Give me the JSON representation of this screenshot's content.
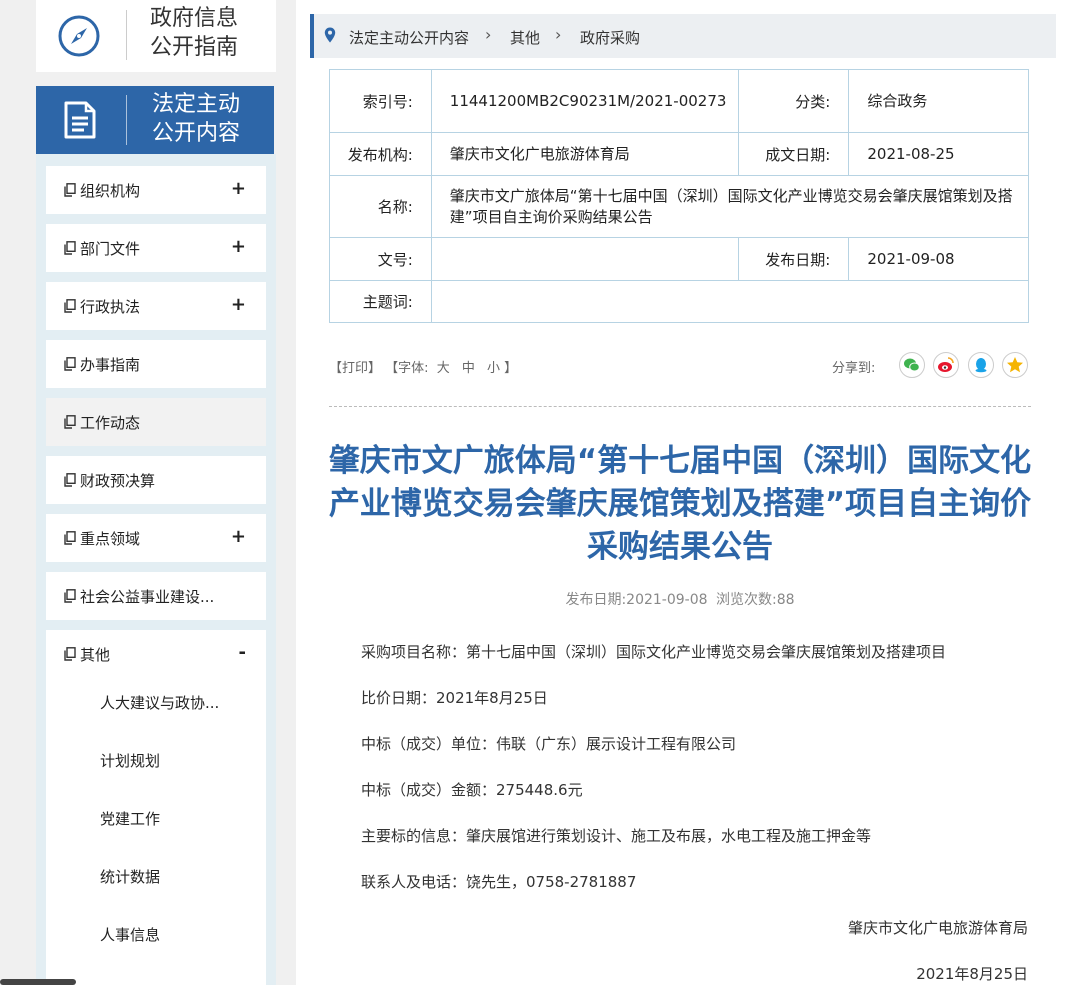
{
  "sidebar": {
    "guide_title_line1": "政府信息",
    "guide_title_line2": "公开指南",
    "legal_title_line1": "法定主动",
    "legal_title_line2": "公开内容",
    "items": [
      {
        "label": "组织机构",
        "toggle": "+"
      },
      {
        "label": "部门文件",
        "toggle": "+"
      },
      {
        "label": "行政执法",
        "toggle": "+"
      },
      {
        "label": "办事指南",
        "toggle": ""
      },
      {
        "label": "工作动态",
        "toggle": ""
      },
      {
        "label": "财政预决算",
        "toggle": ""
      },
      {
        "label": "重点领域",
        "toggle": "+"
      },
      {
        "label": "社会公益事业建设...",
        "toggle": ""
      },
      {
        "label": "其他",
        "toggle": "-"
      }
    ],
    "sub_items": [
      "人大建议与政协...",
      "计划规划",
      "党建工作",
      "统计数据",
      "人事信息"
    ]
  },
  "breadcrumb": [
    "法定主动公开内容",
    "其他",
    "政府采购"
  ],
  "meta": {
    "index_label": "索引号:",
    "index_value": "11441200MB2C90231M/2021-00273",
    "category_label": "分类:",
    "category_value": "综合政务",
    "publisher_label": "发布机构:",
    "publisher_value": "肇庆市文化广电旅游体育局",
    "created_label": "成文日期:",
    "created_value": "2021-08-25",
    "name_label": "名称:",
    "name_value": "肇庆市文广旅体局“第十七届中国（深圳）国际文化产业博览交易会肇庆展馆策划及搭建”项目自主询价采购结果公告",
    "docno_label": "文号:",
    "docno_value": "",
    "pubdate_label": "发布日期:",
    "pubdate_value": "2021-09-08",
    "subject_label": "主题词:",
    "subject_value": ""
  },
  "tools": {
    "print": "【打印】",
    "font": "【字体:",
    "size_large": "大",
    "size_medium": "中",
    "size_small": "小",
    "font_end": "】",
    "share_label": "分享到:"
  },
  "article": {
    "title": "肇庆市文广旅体局“第十七届中国（深圳）国际文化产业博览交易会肇庆展馆策划及搭建”项目自主询价采购结果公告",
    "pub_label": "发布日期:",
    "pub_date": "2021-09-08",
    "views_label": "浏览次数:",
    "views": "88",
    "paragraphs": [
      "采购项目名称：第十七届中国（深圳）国际文化产业博览交易会肇庆展馆策划及搭建项目",
      "比价日期：2021年8月25日",
      "中标（成交）单位：伟联（广东）展示设计工程有限公司",
      "中标（成交）金额：275448.6元",
      "主要标的信息：肇庆展馆进行策划设计、施工及布展，水电工程及施工押金等",
      "联系人及电话：饶先生，0758-2781887"
    ],
    "signature": "肇庆市文化广电旅游体育局",
    "sign_date": "2021年8月25日"
  },
  "colors": {
    "accent": "#2d66a8",
    "sidebar_bg": "#e3eef3",
    "border": "#b7d3e3"
  }
}
